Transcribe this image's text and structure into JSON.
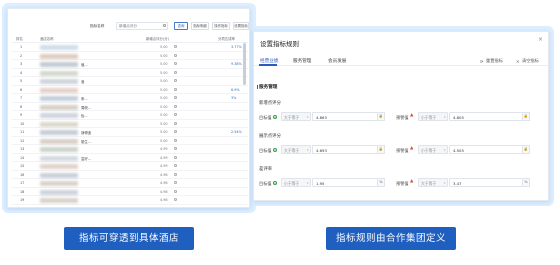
{
  "left_panel": {
    "search_label": "指标名称",
    "search_value": "新增点评分",
    "buttons": [
      "查询",
      "指标明细",
      "操作指标",
      "设置指标"
    ],
    "columns": [
      "排名",
      "酒店名称",
      "新增点评分(分)",
      "分项达成率"
    ],
    "rows": [
      {
        "no": "1",
        "name": "",
        "score": "5.00",
        "rate": "3.77%",
        "color": "#c9d6e6"
      },
      {
        "no": "2",
        "name": "",
        "score": "5.00",
        "rate": "",
        "color": "#d8c3b4"
      },
      {
        "no": "3",
        "name": "值...",
        "score": "5.00",
        "rate": "9.38%",
        "color": "#b7c2cc"
      },
      {
        "no": "4",
        "name": "",
        "score": "5.00",
        "rate": "",
        "color": "#cbd1c1"
      },
      {
        "no": "5",
        "name": "洛",
        "score": "5.00",
        "rate": "",
        "color": "#c7cbd6"
      },
      {
        "no": "6",
        "name": "",
        "score": "5.00",
        "rate": "6.9%",
        "color": "#e0c7c0"
      },
      {
        "no": "7",
        "name": "条...",
        "score": "5.00",
        "rate": "3%",
        "color": "#b9c6d3"
      },
      {
        "no": "8",
        "name": "周皖...",
        "score": "5.00",
        "rate": "",
        "color": "#cfc7ba"
      },
      {
        "no": "9",
        "name": "怡...",
        "score": "5.00",
        "rate": "",
        "color": "#c4cdd8"
      },
      {
        "no": "10",
        "name": "",
        "score": "5.00",
        "rate": "",
        "color": "#d6cfc4"
      },
      {
        "no": "11",
        "name": "静博迪",
        "score": "5.00",
        "rate": "2.54%",
        "color": "#bcc4cf"
      },
      {
        "no": "12",
        "name": "丽生...",
        "score": "5.00",
        "rate": "",
        "color": "#d1c6bd"
      },
      {
        "no": "13",
        "name": "",
        "score": "4.99",
        "rate": "",
        "color": "#c3cbc2"
      },
      {
        "no": "14",
        "name": "富好...",
        "score": "4.99",
        "rate": "",
        "color": "#ccd2dc"
      },
      {
        "no": "15",
        "name": "",
        "score": "4.99",
        "rate": "",
        "color": "#dccbbf"
      },
      {
        "no": "16",
        "name": "",
        "score": "4.98",
        "rate": "",
        "color": "#c0c8d2"
      },
      {
        "no": "17",
        "name": "",
        "score": "4.98",
        "rate": "",
        "color": "#d3cac1"
      },
      {
        "no": "18",
        "name": "",
        "score": "4.98",
        "rate": "",
        "color": "#c5ccd5"
      },
      {
        "no": "19",
        "name": "",
        "score": "4.98",
        "rate": "",
        "color": "#d2c9c0"
      }
    ]
  },
  "right_panel": {
    "title": "设置指标规则",
    "close": "×",
    "tabs": [
      "经营业绩",
      "服务管理",
      "会员发展"
    ],
    "actions": {
      "reset": "重置指标",
      "clear": "清空指标"
    },
    "section": "服务管理",
    "groups": [
      {
        "title": "新增点评分",
        "target_label": "目标值",
        "target_op": "大于等于",
        "target_value": "4.863",
        "warn_label": "预警值",
        "warn_op": "小于等于",
        "warn_value": "4.805",
        "unit": ""
      },
      {
        "title": "展示点评分",
        "target_label": "目标值",
        "target_op": "大于等于",
        "target_value": "4.693",
        "warn_label": "预警值",
        "warn_op": "小于等于",
        "warn_value": "4.505",
        "unit": ""
      },
      {
        "title": "差评率",
        "target_label": "目标值",
        "target_op": "小于等于",
        "target_value": "1.95",
        "warn_label": "预警值",
        "warn_op": "大于等于",
        "warn_value": "3.47",
        "unit": "%"
      }
    ]
  },
  "captions": {
    "left": "指标可穿透到具体酒店",
    "right": "指标规则由合作集团定义"
  },
  "colors": {
    "accent": "#2d5cb8",
    "caption_bg": "#1f5fbf",
    "ok": "#2fa24e",
    "warn": "#e0483a"
  }
}
